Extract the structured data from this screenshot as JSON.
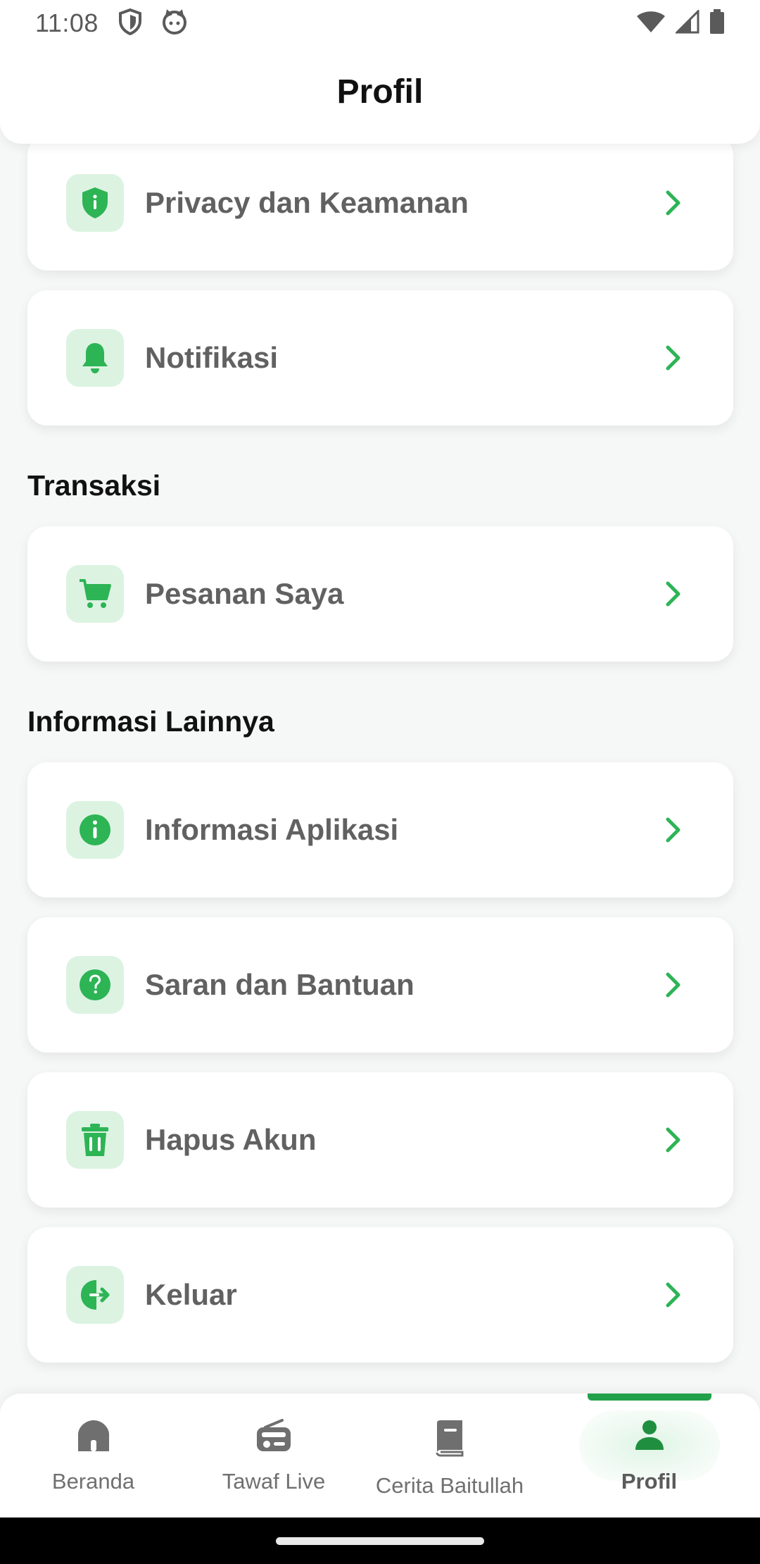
{
  "status_bar": {
    "time": "11:08",
    "left_icons": [
      "shield-icon",
      "cat-face-icon"
    ],
    "right_icons": [
      "wifi-icon",
      "cellular-signal-icon",
      "battery-icon"
    ]
  },
  "header": {
    "title": "Profil"
  },
  "colors": {
    "accent": "#22a04a",
    "icon_bg": "#dcf3e2",
    "label_gray": "#616161",
    "background": "#f6f7f7"
  },
  "account_items": [
    {
      "label": "Privacy dan Keamanan",
      "icon": "shield-alert-icon"
    },
    {
      "label": "Notifikasi",
      "icon": "bell-icon"
    }
  ],
  "sections": {
    "transaksi": {
      "title": "Transaksi",
      "items": [
        {
          "label": "Pesanan Saya",
          "icon": "cart-icon"
        }
      ]
    },
    "informasi": {
      "title": "Informasi Lainnya",
      "items": [
        {
          "label": "Informasi Aplikasi",
          "icon": "info-icon"
        },
        {
          "label": "Saran dan Bantuan",
          "icon": "help-icon"
        },
        {
          "label": "Hapus Akun",
          "icon": "trash-icon"
        },
        {
          "label": "Keluar",
          "icon": "logout-icon"
        }
      ]
    }
  },
  "bottom_nav": [
    {
      "label": "Beranda",
      "icon": "home-icon",
      "active": false
    },
    {
      "label": "Tawaf Live",
      "icon": "radio-icon",
      "active": false
    },
    {
      "label": "Cerita Baitullah",
      "icon": "book-icon",
      "active": false
    },
    {
      "label": "Profil",
      "icon": "person-icon",
      "active": true
    }
  ]
}
